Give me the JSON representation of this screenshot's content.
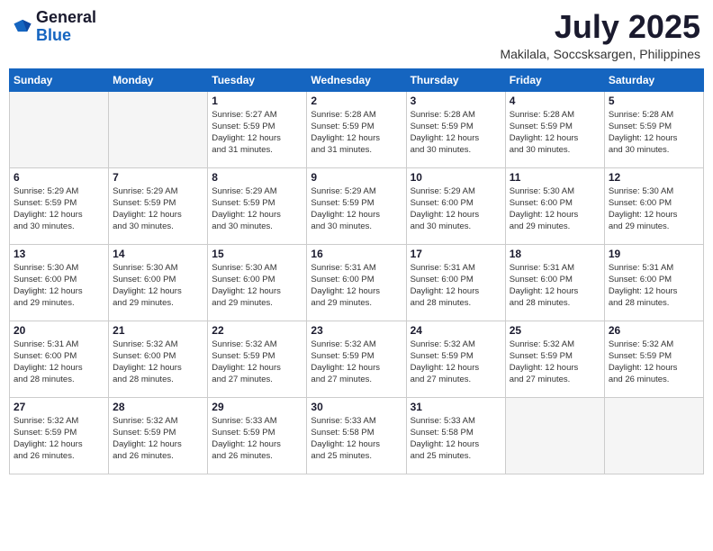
{
  "header": {
    "logo_general": "General",
    "logo_blue": "Blue",
    "title": "July 2025",
    "location": "Makilala, Soccsksargen, Philippines"
  },
  "days_of_week": [
    "Sunday",
    "Monday",
    "Tuesday",
    "Wednesday",
    "Thursday",
    "Friday",
    "Saturday"
  ],
  "weeks": [
    [
      {
        "day": "",
        "info": ""
      },
      {
        "day": "",
        "info": ""
      },
      {
        "day": "1",
        "info": "Sunrise: 5:27 AM\nSunset: 5:59 PM\nDaylight: 12 hours\nand 31 minutes."
      },
      {
        "day": "2",
        "info": "Sunrise: 5:28 AM\nSunset: 5:59 PM\nDaylight: 12 hours\nand 31 minutes."
      },
      {
        "day": "3",
        "info": "Sunrise: 5:28 AM\nSunset: 5:59 PM\nDaylight: 12 hours\nand 30 minutes."
      },
      {
        "day": "4",
        "info": "Sunrise: 5:28 AM\nSunset: 5:59 PM\nDaylight: 12 hours\nand 30 minutes."
      },
      {
        "day": "5",
        "info": "Sunrise: 5:28 AM\nSunset: 5:59 PM\nDaylight: 12 hours\nand 30 minutes."
      }
    ],
    [
      {
        "day": "6",
        "info": "Sunrise: 5:29 AM\nSunset: 5:59 PM\nDaylight: 12 hours\nand 30 minutes."
      },
      {
        "day": "7",
        "info": "Sunrise: 5:29 AM\nSunset: 5:59 PM\nDaylight: 12 hours\nand 30 minutes."
      },
      {
        "day": "8",
        "info": "Sunrise: 5:29 AM\nSunset: 5:59 PM\nDaylight: 12 hours\nand 30 minutes."
      },
      {
        "day": "9",
        "info": "Sunrise: 5:29 AM\nSunset: 5:59 PM\nDaylight: 12 hours\nand 30 minutes."
      },
      {
        "day": "10",
        "info": "Sunrise: 5:29 AM\nSunset: 6:00 PM\nDaylight: 12 hours\nand 30 minutes."
      },
      {
        "day": "11",
        "info": "Sunrise: 5:30 AM\nSunset: 6:00 PM\nDaylight: 12 hours\nand 29 minutes."
      },
      {
        "day": "12",
        "info": "Sunrise: 5:30 AM\nSunset: 6:00 PM\nDaylight: 12 hours\nand 29 minutes."
      }
    ],
    [
      {
        "day": "13",
        "info": "Sunrise: 5:30 AM\nSunset: 6:00 PM\nDaylight: 12 hours\nand 29 minutes."
      },
      {
        "day": "14",
        "info": "Sunrise: 5:30 AM\nSunset: 6:00 PM\nDaylight: 12 hours\nand 29 minutes."
      },
      {
        "day": "15",
        "info": "Sunrise: 5:30 AM\nSunset: 6:00 PM\nDaylight: 12 hours\nand 29 minutes."
      },
      {
        "day": "16",
        "info": "Sunrise: 5:31 AM\nSunset: 6:00 PM\nDaylight: 12 hours\nand 29 minutes."
      },
      {
        "day": "17",
        "info": "Sunrise: 5:31 AM\nSunset: 6:00 PM\nDaylight: 12 hours\nand 28 minutes."
      },
      {
        "day": "18",
        "info": "Sunrise: 5:31 AM\nSunset: 6:00 PM\nDaylight: 12 hours\nand 28 minutes."
      },
      {
        "day": "19",
        "info": "Sunrise: 5:31 AM\nSunset: 6:00 PM\nDaylight: 12 hours\nand 28 minutes."
      }
    ],
    [
      {
        "day": "20",
        "info": "Sunrise: 5:31 AM\nSunset: 6:00 PM\nDaylight: 12 hours\nand 28 minutes."
      },
      {
        "day": "21",
        "info": "Sunrise: 5:32 AM\nSunset: 6:00 PM\nDaylight: 12 hours\nand 28 minutes."
      },
      {
        "day": "22",
        "info": "Sunrise: 5:32 AM\nSunset: 5:59 PM\nDaylight: 12 hours\nand 27 minutes."
      },
      {
        "day": "23",
        "info": "Sunrise: 5:32 AM\nSunset: 5:59 PM\nDaylight: 12 hours\nand 27 minutes."
      },
      {
        "day": "24",
        "info": "Sunrise: 5:32 AM\nSunset: 5:59 PM\nDaylight: 12 hours\nand 27 minutes."
      },
      {
        "day": "25",
        "info": "Sunrise: 5:32 AM\nSunset: 5:59 PM\nDaylight: 12 hours\nand 27 minutes."
      },
      {
        "day": "26",
        "info": "Sunrise: 5:32 AM\nSunset: 5:59 PM\nDaylight: 12 hours\nand 26 minutes."
      }
    ],
    [
      {
        "day": "27",
        "info": "Sunrise: 5:32 AM\nSunset: 5:59 PM\nDaylight: 12 hours\nand 26 minutes."
      },
      {
        "day": "28",
        "info": "Sunrise: 5:32 AM\nSunset: 5:59 PM\nDaylight: 12 hours\nand 26 minutes."
      },
      {
        "day": "29",
        "info": "Sunrise: 5:33 AM\nSunset: 5:59 PM\nDaylight: 12 hours\nand 26 minutes."
      },
      {
        "day": "30",
        "info": "Sunrise: 5:33 AM\nSunset: 5:58 PM\nDaylight: 12 hours\nand 25 minutes."
      },
      {
        "day": "31",
        "info": "Sunrise: 5:33 AM\nSunset: 5:58 PM\nDaylight: 12 hours\nand 25 minutes."
      },
      {
        "day": "",
        "info": ""
      },
      {
        "day": "",
        "info": ""
      }
    ]
  ]
}
